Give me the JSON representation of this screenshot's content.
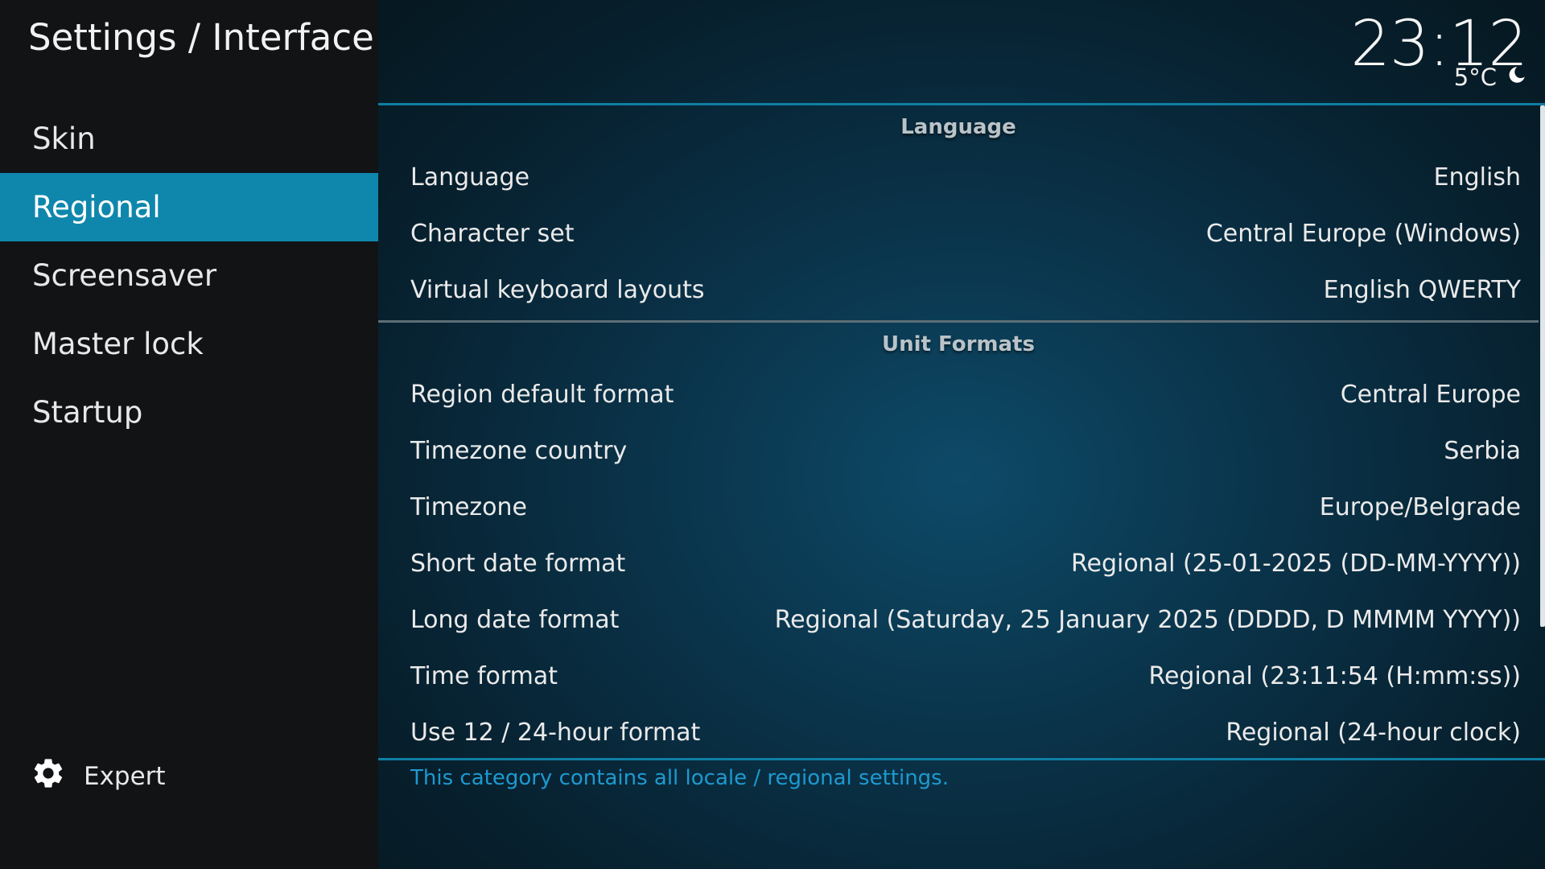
{
  "header": {
    "title": "Settings / Interface"
  },
  "sidebar": {
    "items": [
      {
        "label": "Skin",
        "active": false
      },
      {
        "label": "Regional",
        "active": true
      },
      {
        "label": "Screensaver",
        "active": false
      },
      {
        "label": "Master lock",
        "active": false
      },
      {
        "label": "Startup",
        "active": false
      }
    ],
    "expert": {
      "label": "Expert",
      "icon": "gear-icon"
    }
  },
  "status": {
    "time": "23:12",
    "temperature": "5°C",
    "weather_icon": "moon-icon"
  },
  "sections": [
    {
      "header": "Language",
      "rows": [
        {
          "label": "Language",
          "value": "English"
        },
        {
          "label": "Character set",
          "value": "Central Europe (Windows)"
        },
        {
          "label": "Virtual keyboard layouts",
          "value": "English QWERTY"
        }
      ]
    },
    {
      "header": "Unit Formats",
      "rows": [
        {
          "label": "Region default format",
          "value": "Central Europe"
        },
        {
          "label": "Timezone country",
          "value": "Serbia"
        },
        {
          "label": "Timezone",
          "value": "Europe/Belgrade"
        },
        {
          "label": "Short date format",
          "value": "Regional (25-01-2025 (DD-MM-YYYY))"
        },
        {
          "label": "Long date format",
          "value": "Regional (Saturday, 25 January 2025 (DDDD, D MMMM YYYY))"
        },
        {
          "label": "Time format",
          "value": "Regional (23:11:54 (H:mm:ss))"
        },
        {
          "label": "Use 12 / 24-hour format",
          "value": "Regional (24-hour clock)"
        }
      ]
    }
  ],
  "description": "This category contains all locale / regional settings.",
  "colors": {
    "accent": "#0f87ad",
    "description_text": "#1d9ad0"
  }
}
